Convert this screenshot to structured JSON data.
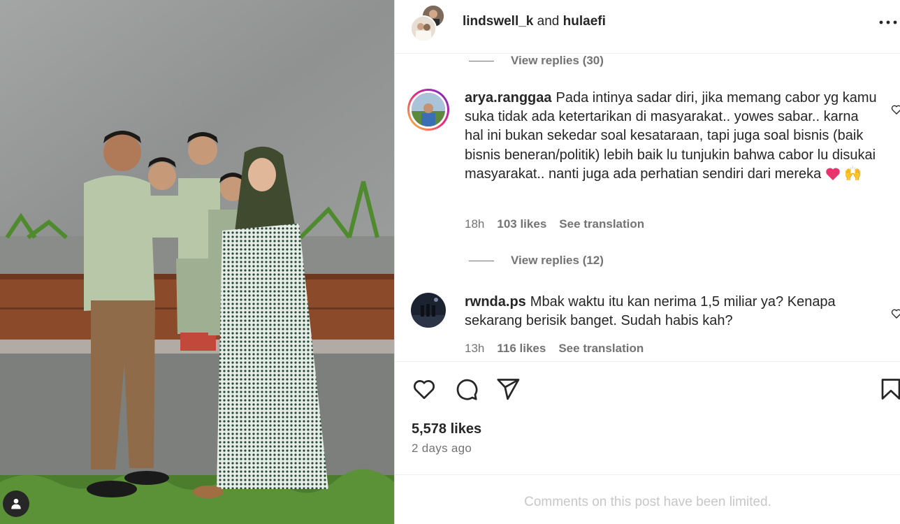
{
  "post": {
    "authors": {
      "first": "lindswell_k",
      "conjunction": " and ",
      "second": "hulaefi"
    }
  },
  "comments": {
    "replies_1": "View replies (30)",
    "replies_2": "View replies (12)",
    "items": [
      {
        "username": "arya.ranggaa",
        "text": "Pada intinya sadar diri, jika memang cabor yg kamu suka tidak ada ketertarikan di masyarakat.. yowes sabar.. karna hal ini bukan sekedar soal kesataraan, tapi juga soal bisnis (baik bisnis beneran/politik) lebih baik lu tunjukin bahwa cabor lu disukai masyarakat.. nanti juga ada perhatian sendiri dari mereka",
        "emoji_hands": "🙌",
        "time": "18h",
        "likes": "103 likes",
        "translate": "See translation"
      },
      {
        "username": "rwnda.ps",
        "text": "Mbak waktu itu kan nerima 1,5 miliar ya? Kenapa sekarang berisik banget. Sudah habis kah?",
        "time": "13h",
        "likes": "116 likes",
        "translate": "See translation"
      }
    ]
  },
  "stats": {
    "likes": "5,578 likes",
    "time_ago": "2 days ago"
  },
  "footer": {
    "limited": "Comments on this post have been limited."
  },
  "icons": {
    "more": "more-options-icon",
    "like": "heart-icon",
    "comment": "comment-icon",
    "share": "share-icon",
    "save": "bookmark-icon",
    "user_tag": "user-tag-icon"
  },
  "colors": {
    "secondary_text": "#737373",
    "primary_text": "#262626",
    "emoji_heart": "#e8336d",
    "limited_text": "#c7c7c7"
  }
}
